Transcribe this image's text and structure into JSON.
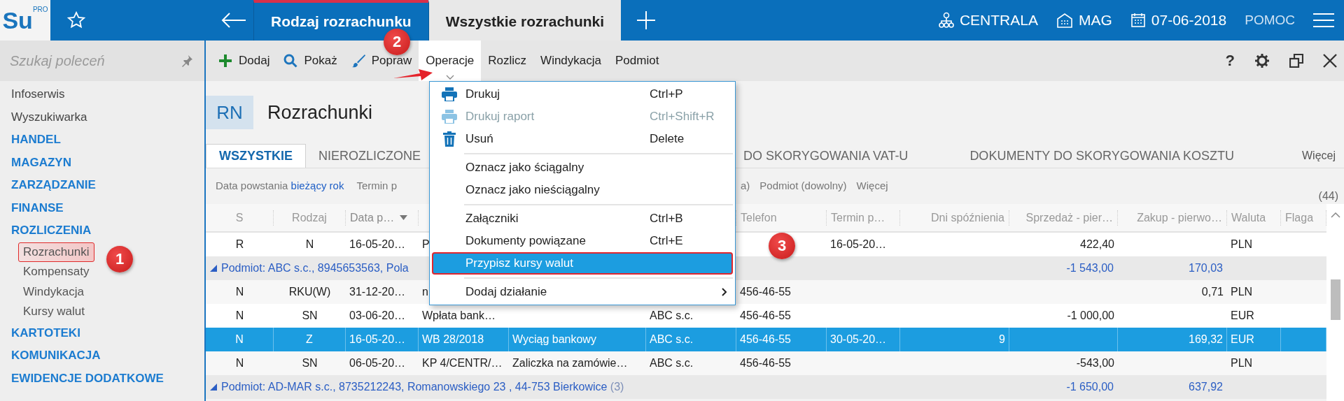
{
  "top_bar": {
    "logo": {
      "text": "Su",
      "superscript": "PRO"
    },
    "tabs": [
      {
        "label": "Rodzaj rozrachunku",
        "selected": false
      },
      {
        "label": "Wszystkie rozrachunki",
        "selected": true
      }
    ],
    "status": [
      {
        "label": "CENTRALA",
        "kind": "branch"
      },
      {
        "label": "MAG",
        "kind": "warehouse"
      },
      {
        "label": "07-06-2018",
        "kind": "date"
      }
    ],
    "help": "POMOC"
  },
  "sidebar": {
    "search": {
      "placeholder": "Szukaj poleceń"
    },
    "items": [
      {
        "label": "Infoserwis",
        "kind": "link"
      },
      {
        "label": "Wyszukiwarka",
        "kind": "link"
      },
      {
        "label": "HANDEL",
        "kind": "section"
      },
      {
        "label": "MAGAZYN",
        "kind": "section"
      },
      {
        "label": "ZARZĄDZANIE",
        "kind": "section"
      },
      {
        "label": "FINANSE",
        "kind": "section"
      },
      {
        "label": "ROZLICZENIA",
        "kind": "section",
        "children": [
          {
            "label": "Rozrachunki",
            "selected": true
          },
          {
            "label": "Kompensaty",
            "selected": false
          },
          {
            "label": "Windykacja",
            "selected": false
          },
          {
            "label": "Kursy walut",
            "selected": false
          }
        ]
      },
      {
        "label": "KARTOTEKI",
        "kind": "section"
      },
      {
        "label": "KOMUNIKACJA",
        "kind": "section"
      },
      {
        "label": "EWIDENCJE DODATKOWE",
        "kind": "section"
      }
    ]
  },
  "toolbar": {
    "buttons": [
      {
        "label": "Dodaj",
        "kind": "add",
        "selected": false
      },
      {
        "label": "Pokaż",
        "kind": "view",
        "selected": false
      },
      {
        "label": "Popraw",
        "kind": "edit",
        "selected": false
      },
      {
        "label": "Operacje",
        "kind": "menu",
        "selected": true
      },
      {
        "label": "Rozlicz",
        "kind": "plain",
        "selected": false
      },
      {
        "label": "Windykacja",
        "kind": "plain",
        "selected": false
      },
      {
        "label": "Podmiot",
        "kind": "plain",
        "selected": false
      }
    ],
    "help": "?"
  },
  "document": {
    "code": "RN",
    "title": "Rozrachunki"
  },
  "view_tabs": {
    "tabs": [
      {
        "label": "WSZYSTKIE",
        "selected": true
      },
      {
        "label": "NIEROZLICZONE",
        "selected": false
      },
      {
        "label": "DO SKORYGOWANIA VAT-U",
        "selected": false
      },
      {
        "label": "DOKUMENTY DO SKORYGOWANIA KOSZTU",
        "selected": false
      }
    ],
    "more": "Więcej"
  },
  "filters": {
    "items": [
      {
        "label": "Data powstania",
        "value": "bieżący rok"
      },
      {
        "label": "Termin p"
      },
      {
        "label": "a)"
      },
      {
        "label": "Podmiot (dowolny)"
      },
      {
        "label": "Więcej"
      }
    ],
    "count": "(44)"
  },
  "table": {
    "columns": [
      {
        "label": "S",
        "sorted": false
      },
      {
        "label": "Rodzaj",
        "sorted": false
      },
      {
        "label": "Data p…",
        "sorted": true
      },
      null,
      null,
      null,
      {
        "label": "Telefon",
        "sorted": false
      },
      {
        "label": "Termin p…",
        "sorted": false
      },
      {
        "label": "Dni spóźnienia",
        "sorted": false
      },
      {
        "label": "Sprzedaż - pier…",
        "sorted": false
      },
      {
        "label": "Zakup - pierwo…",
        "sorted": false
      },
      {
        "label": "Waluta",
        "sorted": false
      },
      {
        "label": "Flaga",
        "sorted": false
      }
    ],
    "rows": [
      {
        "kind": "record",
        "selected": false,
        "cells": [
          "R",
          "N",
          "16-05-20…",
          "P",
          null,
          null,
          null,
          "16-05-20…",
          null,
          "422,40",
          null,
          "PLN",
          null
        ]
      },
      {
        "kind": "group",
        "expanded": true,
        "label": "Podmiot: ABC s.c., 8945653563, Pola",
        "cells": [
          null,
          null,
          null,
          null,
          null,
          null,
          null,
          null,
          null,
          "-1 543,00",
          "170,03",
          null,
          null
        ]
      },
      {
        "kind": "record",
        "selected": false,
        "cells": [
          "N",
          "RKU(W)",
          "31-12-20…",
          "n",
          null,
          null,
          "456-46-55",
          null,
          null,
          null,
          "0,71",
          "PLN",
          null
        ]
      },
      {
        "kind": "record",
        "selected": false,
        "cells": [
          "N",
          "SN",
          "03-06-20…",
          "Wpłata bank…",
          null,
          "ABC s.c.",
          "456-46-55",
          null,
          null,
          "-1 000,00",
          null,
          "EUR",
          null
        ]
      },
      {
        "kind": "record",
        "selected": true,
        "cells": [
          "N",
          "Z",
          "16-05-20…",
          "WB 28/2018",
          "Wyciąg bankowy",
          "ABC s.c.",
          "456-46-55",
          "30-05-20…",
          "9",
          null,
          "169,32",
          "EUR",
          null
        ]
      },
      {
        "kind": "record",
        "selected": false,
        "cells": [
          "N",
          "SN",
          "06-05-20…",
          "KP 4/CENTR/…",
          "Zaliczka na zamówie…",
          "ABC s.c.",
          "456-46-55",
          null,
          null,
          "-543,00",
          null,
          "PLN",
          null
        ]
      },
      {
        "kind": "group",
        "expanded": true,
        "label": "Podmiot: AD-MAR s.c., 8735212243, Romanowskiego 23 , 44-753 Bierkowice",
        "count": "(3)",
        "cells": [
          null,
          null,
          null,
          null,
          null,
          null,
          null,
          null,
          null,
          "-1 650,00",
          "637,92",
          null,
          null
        ]
      }
    ]
  },
  "menu": {
    "groups": [
      {
        "items": [
          {
            "label": "Drukuj",
            "kind": "print",
            "shortcut": "Ctrl+P",
            "disabled": false,
            "selected": false,
            "submenu": false
          },
          {
            "label": "Drukuj raport",
            "kind": "print",
            "shortcut": "Ctrl+Shift+R",
            "disabled": true,
            "selected": false,
            "submenu": false
          },
          {
            "label": "Usuń",
            "kind": "delete",
            "shortcut": "Delete",
            "disabled": false,
            "selected": false,
            "submenu": false
          }
        ]
      },
      {
        "items": [
          {
            "label": "Oznacz jako ściągalny",
            "disabled": false,
            "selected": false,
            "submenu": false
          },
          {
            "label": "Oznacz jako nieściągalny",
            "disabled": false,
            "selected": false,
            "submenu": false
          }
        ]
      },
      {
        "items": [
          {
            "label": "Załączniki",
            "shortcut": "Ctrl+B",
            "disabled": false,
            "selected": false,
            "submenu": false
          },
          {
            "label": "Dokumenty powiązane",
            "shortcut": "Ctrl+E",
            "disabled": false,
            "selected": false,
            "submenu": false
          },
          {
            "label": "Przypisz kursy walut",
            "disabled": false,
            "selected": true,
            "submenu": false
          }
        ]
      },
      {
        "items": [
          {
            "label": "Dodaj działanie",
            "disabled": false,
            "selected": false,
            "submenu": true
          }
        ]
      }
    ]
  },
  "annotations": [
    {
      "label": "2",
      "kind": "toolbar"
    },
    {
      "label": "3",
      "kind": "menu"
    },
    {
      "label": "1",
      "kind": "sidebar"
    }
  ]
}
